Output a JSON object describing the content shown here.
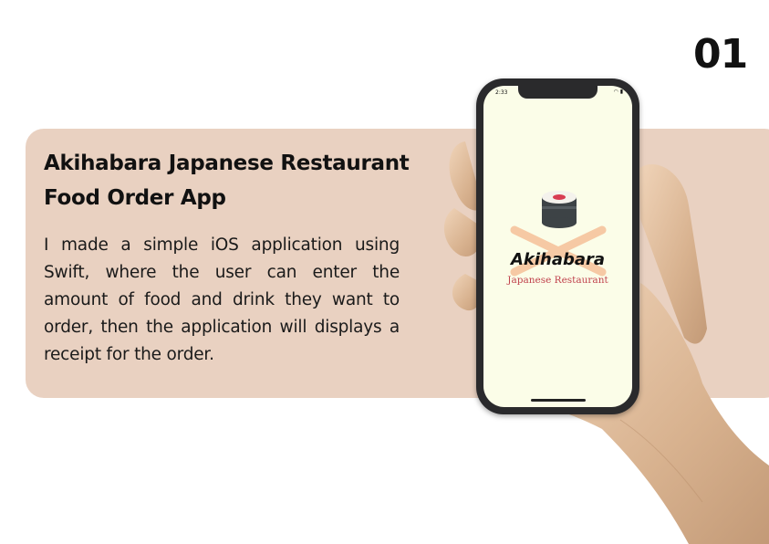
{
  "page_number": "01",
  "project": {
    "title_line1": "Akihabara Japanese Restaurant",
    "title_line2": "Food Order App",
    "description": "I made a simple iOS application using Swift, where the user can enter the amount of food and drink they want to order, then the application will displays a receipt for the order."
  },
  "phone": {
    "status_time": "2:33",
    "app_name": "Akihabara",
    "app_subtitle": "Japanese Restaurant"
  },
  "colors": {
    "card_background": "#e9d1c1",
    "screen_background": "#fbfde8",
    "accent_red": "#c0424d"
  },
  "icons": [
    "sushi-icon",
    "chopsticks-icon",
    "wifi-icon",
    "battery-icon"
  ]
}
